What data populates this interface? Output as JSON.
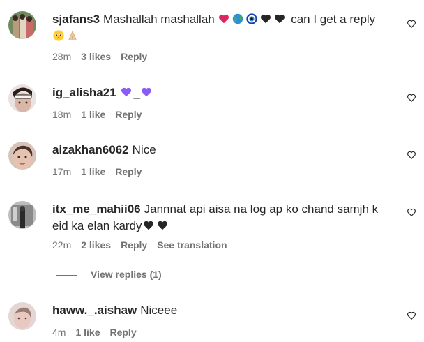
{
  "comments": [
    {
      "username": "sjafans3",
      "text": "Mashallah mashallah",
      "text_suffix": "can I get a reply",
      "time": "28m",
      "likes": "3 likes",
      "reply": "Reply"
    },
    {
      "username": "ig_alisha21",
      "text": "_",
      "time": "18m",
      "likes": "1 like",
      "reply": "Reply"
    },
    {
      "username": "aizakhan6062",
      "text": "Nice",
      "time": "17m",
      "likes": "1 like",
      "reply": "Reply"
    },
    {
      "username": "itx_me_mahii06",
      "text": "Jannnat api aisa na log ap ko chand samjh k eid ka elan kardy",
      "time": "22m",
      "likes": "2 likes",
      "reply": "Reply",
      "translate": "See translation"
    },
    {
      "username": "haww._.aishaw",
      "text": "Niceee",
      "time": "4m",
      "likes": "1 like",
      "reply": "Reply"
    }
  ],
  "view_replies": "View replies (1)",
  "colors": {
    "text": "#262626",
    "muted": "#737373",
    "red_heart": "#e0245e",
    "purple_heart": "#8b5cf6",
    "black_heart": "#262626"
  },
  "icons": [
    "heart-outline-icon",
    "red-heart-emoji",
    "globe-emoji",
    "evil-eye-emoji",
    "black-heart-emoji",
    "purple-heart-emoji",
    "pleading-face-emoji",
    "folded-hands-emoji"
  ]
}
